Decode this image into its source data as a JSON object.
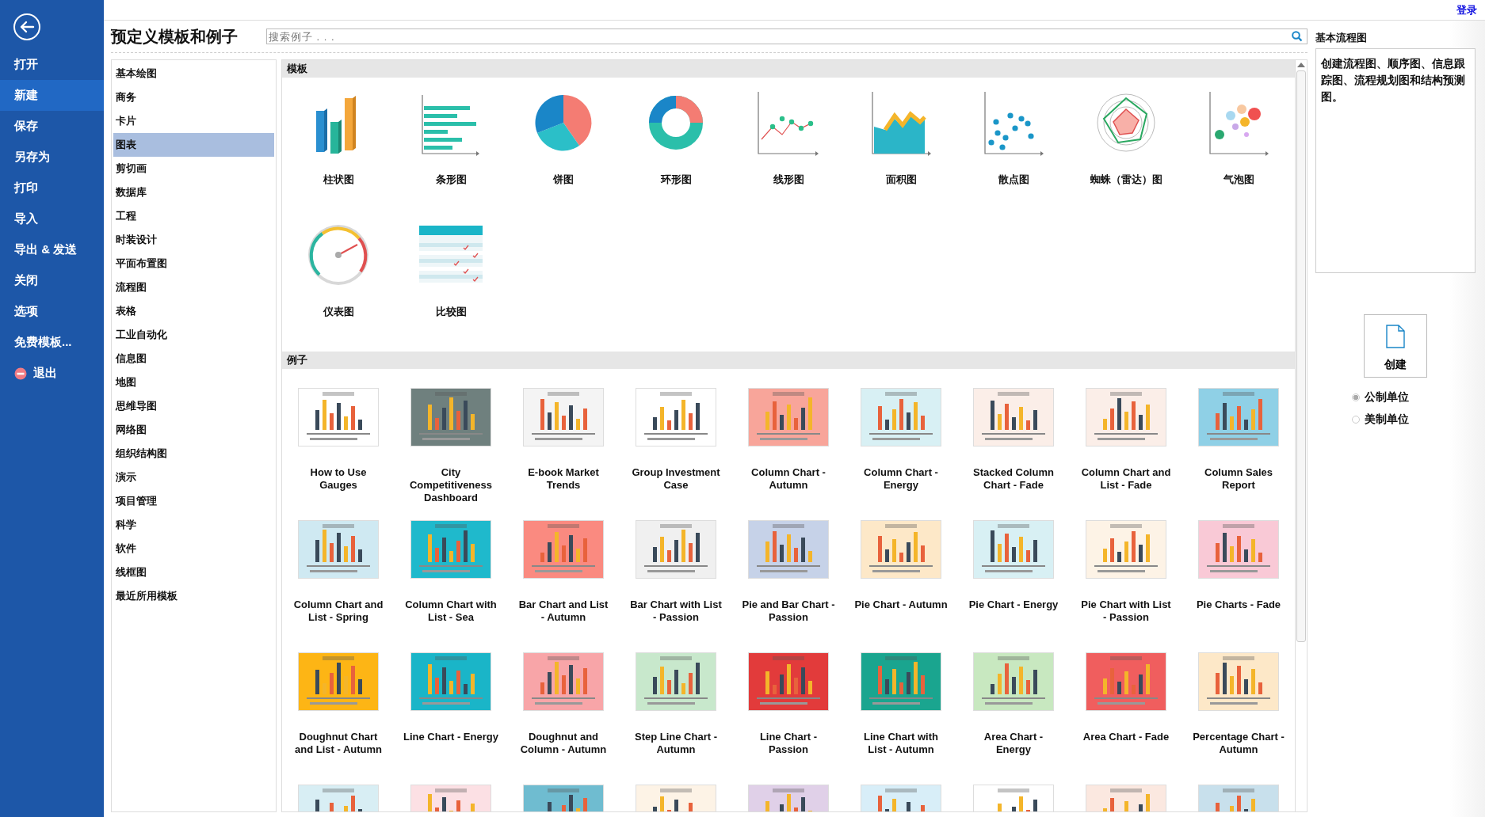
{
  "top_bar": {
    "login_link": "登录"
  },
  "sidebar": {
    "items": [
      {
        "label": "打开",
        "selected": false,
        "kind": "text"
      },
      {
        "label": "新建",
        "selected": true,
        "kind": "text"
      },
      {
        "label": "保存",
        "selected": false,
        "kind": "text"
      },
      {
        "label": "另存为",
        "selected": false,
        "kind": "text"
      },
      {
        "label": "打印",
        "selected": false,
        "kind": "text"
      },
      {
        "label": "导入",
        "selected": false,
        "kind": "text"
      },
      {
        "label": "导出 & 发送",
        "selected": false,
        "kind": "text"
      },
      {
        "label": "关闭",
        "selected": false,
        "kind": "text"
      },
      {
        "label": "选项",
        "selected": false,
        "kind": "text"
      },
      {
        "label": "免费模板...",
        "selected": false,
        "kind": "text"
      },
      {
        "label": "退出",
        "selected": false,
        "kind": "exit"
      }
    ]
  },
  "title": "预定义模板和例子",
  "search": {
    "placeholder": "搜索例子 . . ."
  },
  "categories": [
    {
      "label": "基本绘图",
      "selected": false
    },
    {
      "label": "商务",
      "selected": false
    },
    {
      "label": "卡片",
      "selected": false
    },
    {
      "label": "图表",
      "selected": true
    },
    {
      "label": "剪切画",
      "selected": false
    },
    {
      "label": "数据库",
      "selected": false
    },
    {
      "label": "工程",
      "selected": false
    },
    {
      "label": "时装设计",
      "selected": false
    },
    {
      "label": "平面布置图",
      "selected": false
    },
    {
      "label": "流程图",
      "selected": false
    },
    {
      "label": "表格",
      "selected": false
    },
    {
      "label": "工业自动化",
      "selected": false
    },
    {
      "label": "信息图",
      "selected": false
    },
    {
      "label": "地图",
      "selected": false
    },
    {
      "label": "思维导图",
      "selected": false
    },
    {
      "label": "网络图",
      "selected": false
    },
    {
      "label": "组织结构图",
      "selected": false
    },
    {
      "label": "演示",
      "selected": false
    },
    {
      "label": "项目管理",
      "selected": false
    },
    {
      "label": "科学",
      "selected": false
    },
    {
      "label": "软件",
      "selected": false
    },
    {
      "label": "线框图",
      "selected": false
    },
    {
      "label": "最近所用模板",
      "selected": false
    }
  ],
  "templates_section": {
    "heading": "模板",
    "items": [
      {
        "label": "柱状图",
        "kind": "column"
      },
      {
        "label": "条形图",
        "kind": "bar"
      },
      {
        "label": "饼图",
        "kind": "pie"
      },
      {
        "label": "环形图",
        "kind": "donut"
      },
      {
        "label": "线形图",
        "kind": "line"
      },
      {
        "label": "面积图",
        "kind": "area"
      },
      {
        "label": "散点图",
        "kind": "scatter"
      },
      {
        "label": "蜘蛛（雷达）图",
        "kind": "radar"
      },
      {
        "label": "气泡图",
        "kind": "bubble"
      },
      {
        "label": "仪表图",
        "kind": "gauge"
      },
      {
        "label": "比较图",
        "kind": "comparison"
      }
    ]
  },
  "examples_section": {
    "heading": "例子",
    "items": [
      {
        "label": "How to Use Gauges",
        "color": "#ffffff"
      },
      {
        "label": "City Competitiveness Dashboard",
        "color": "#6f807e"
      },
      {
        "label": "E-book Market Trends",
        "color": "#f4f4f4"
      },
      {
        "label": "Group Investment Case",
        "color": "#ffffff"
      },
      {
        "label": "Column Chart - Autumn",
        "color": "#f8a59a"
      },
      {
        "label": "Column Chart - Energy",
        "color": "#d8f0f4"
      },
      {
        "label": "Stacked Column Chart - Fade",
        "color": "#fbeee8"
      },
      {
        "label": "Column Chart and List - Fade",
        "color": "#fbeee8"
      },
      {
        "label": "Column Sales Report",
        "color": "#8fd0e6"
      },
      {
        "label": "Column Chart and List - Spring",
        "color": "#cfe9f2"
      },
      {
        "label": "Column Chart with List - Sea",
        "color": "#1fb9cc"
      },
      {
        "label": "Bar Chart and List - Autumn",
        "color": "#fa8a80"
      },
      {
        "label": "Bar Chart with List - Passion",
        "color": "#f0f0f0"
      },
      {
        "label": "Pie and Bar Chart - Passion",
        "color": "#c6d2e8"
      },
      {
        "label": "Pie Chart - Autumn",
        "color": "#fde8c8"
      },
      {
        "label": "Pie Chart - Energy",
        "color": "#d8f0f4"
      },
      {
        "label": "Pie Chart with List - Passion",
        "color": "#fdf3e6"
      },
      {
        "label": "Pie Charts - Fade",
        "color": "#f9c9d6"
      },
      {
        "label": "Doughnut Chart and List - Autumn",
        "color": "#fdb515"
      },
      {
        "label": "Line Chart - Energy",
        "color": "#1ab5c8"
      },
      {
        "label": "Doughnut and Column - Autumn",
        "color": "#f8a5a8"
      },
      {
        "label": "Step Line Chart - Autumn",
        "color": "#c8e8cc"
      },
      {
        "label": "Line Chart - Passion",
        "color": "#e23b3b"
      },
      {
        "label": "Line Chart with List - Autumn",
        "color": "#1aa58f"
      },
      {
        "label": "Area Chart - Energy",
        "color": "#c8e8c0"
      },
      {
        "label": "Area Chart - Fade",
        "color": "#f05e5e"
      },
      {
        "label": "Percentage Chart - Autumn",
        "color": "#fde8c8"
      },
      {
        "color": "#d8eef4"
      },
      {
        "color": "#fce0e4"
      },
      {
        "color": "#6fbcd0"
      },
      {
        "color": "#fdf3e6"
      },
      {
        "color": "#e0d0e8"
      },
      {
        "color": "#d8eef8"
      },
      {
        "color": "#ffffff"
      },
      {
        "color": "#fbe8e0"
      },
      {
        "color": "#c8e0ec"
      }
    ]
  },
  "details": {
    "heading": "基本流程图",
    "description": "创建流程图、顺序图、信息跟踪图、流程规划图和结构预测图。",
    "create_button": "创建",
    "units": [
      {
        "label": "公制单位",
        "selected": true
      },
      {
        "label": "美制单位",
        "selected": false
      }
    ]
  }
}
